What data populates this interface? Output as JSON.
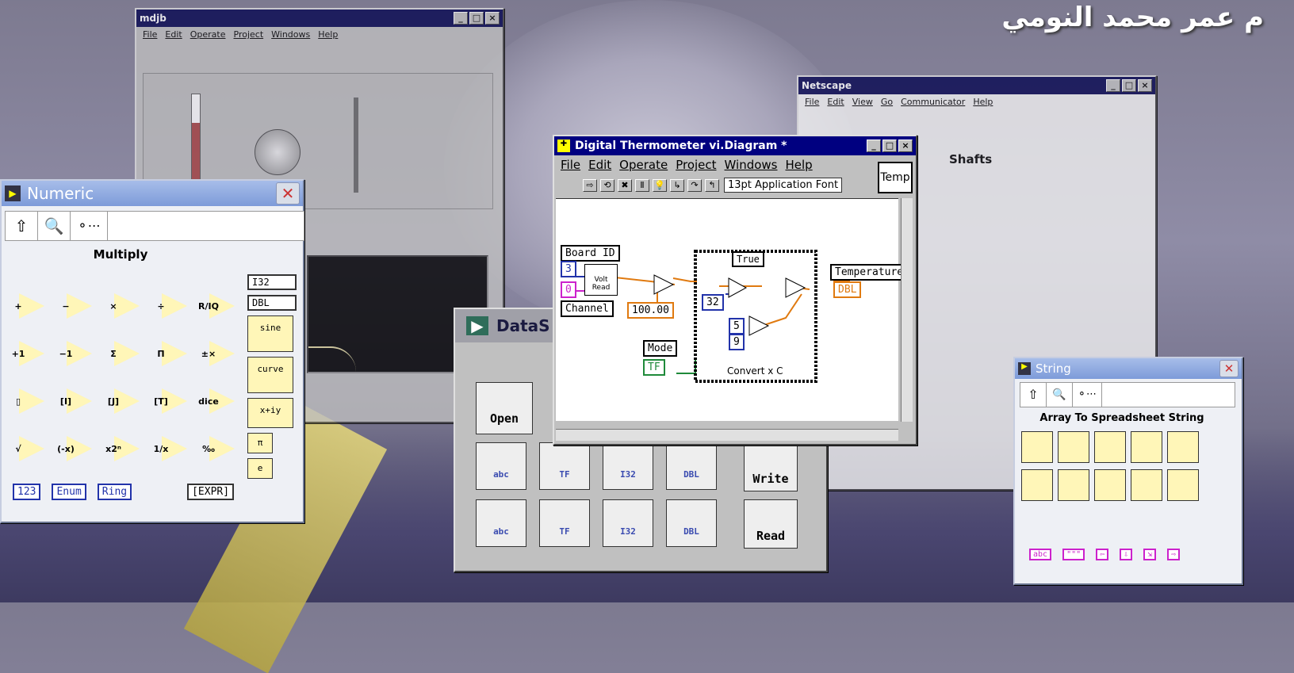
{
  "overlay": {
    "arabic_title": "م عمر محمد النومي"
  },
  "back_window": {
    "title": "mdjb",
    "menu": [
      "File",
      "Edit",
      "Operate",
      "Project",
      "Windows",
      "Help"
    ]
  },
  "browser_window": {
    "title": "Netscape",
    "menu": [
      "File",
      "Edit",
      "View",
      "Go",
      "Communicator",
      "Help"
    ],
    "heading": "Shafts"
  },
  "numeric_palette": {
    "title": "Numeric",
    "selected_label": "Multiply",
    "rows": [
      [
        "+",
        "−",
        "×",
        "÷",
        "R/IQ"
      ],
      [
        "+1",
        "−1",
        "Σ",
        "Π",
        "±×"
      ],
      [
        "▯",
        "[I]",
        "[J]",
        "[T]",
        "dice"
      ],
      [
        "√",
        "(-x)",
        "x2ⁿ",
        "1/x",
        "‰"
      ]
    ],
    "bottom_items": [
      "123",
      "Enum",
      "Ring",
      "[EXPR]"
    ],
    "side_items": [
      "I32",
      "DBL",
      "sine",
      "curve",
      "x+iy",
      "π",
      "e"
    ]
  },
  "datasocket_window": {
    "title": "DataS",
    "open_label": "Open",
    "write_label": "Write",
    "read_label": "Read",
    "row1": [
      "abc",
      "TF",
      "I32",
      "DBL"
    ],
    "row2": [
      "abc",
      "TF",
      "I32",
      "DBL"
    ]
  },
  "diagram_window": {
    "title": "Digital Thermometer vi.Diagram *",
    "menu": [
      "File",
      "Edit",
      "Operate",
      "Project",
      "Windows",
      "Help"
    ],
    "font_selector": "13pt Application Font",
    "icon_label": "Temp",
    "nodes": {
      "board_id": "Board ID",
      "board_id_val": "3",
      "channel": "Channel",
      "channel_val": "0",
      "volt_read": "Volt Read",
      "constant_100": "100.00",
      "mode": "Mode",
      "mode_val": "TF",
      "case_selector": "True",
      "const_32": "32",
      "const_5": "5",
      "const_9": "9",
      "case_caption": "Convert x C",
      "temperature": "Temperature",
      "temperature_type": "DBL"
    }
  },
  "string_palette": {
    "title": "String",
    "selected_label": "Array To Spreadsheet String",
    "bottom_items": [
      "abc",
      "\"\"\"",
      "⇦",
      "⇩",
      "⇲",
      "⇨"
    ]
  },
  "colors": {
    "title_blue": "#000080",
    "xp_title": "#7d9bd9",
    "wire_orange": "#e07a10",
    "wire_blue": "#2233aa",
    "wire_green": "#1f8a3a",
    "wire_pink": "#cc22cc"
  }
}
